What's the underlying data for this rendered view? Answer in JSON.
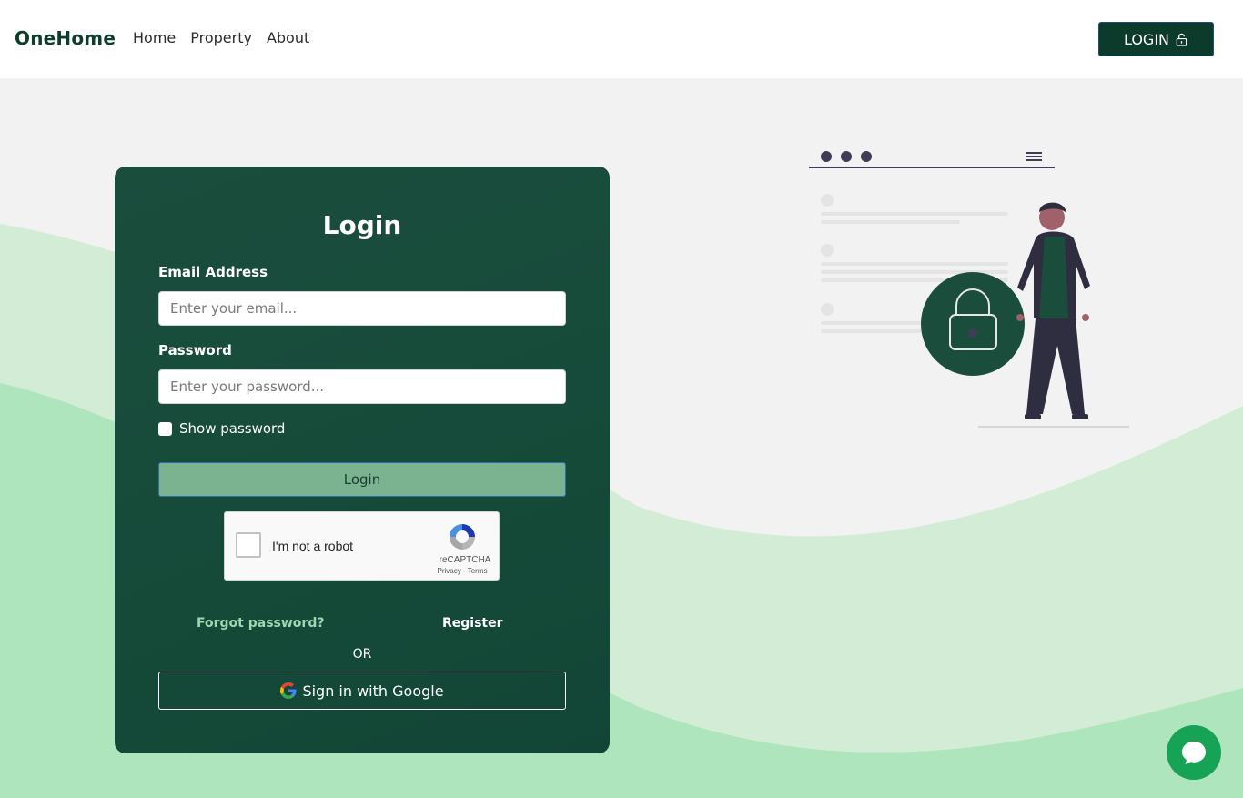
{
  "header": {
    "brand": "OneHome",
    "nav": [
      "Home",
      "Property",
      "About"
    ],
    "login_label": "LOGIN"
  },
  "form": {
    "title": "Login",
    "email_label": "Email Address",
    "email_placeholder": "Enter your email...",
    "password_label": "Password",
    "password_placeholder": "Enter your password...",
    "show_password_label": "Show password",
    "submit_label": "Login",
    "recaptcha": {
      "label": "I'm not a robot",
      "brand": "reCAPTCHA",
      "links": "Privacy - Terms"
    },
    "forgot_label": "Forgot password?",
    "register_label": "Register",
    "or_label": "OR",
    "google_label": "Sign in with Google"
  },
  "colors": {
    "brand_green": "#0c3b2b",
    "card_green": "#1b4d3d",
    "button_green": "#7bb28f",
    "chat_green": "#17a355",
    "wave_light": "#d3ecd6",
    "wave_mid": "#aee5bd"
  },
  "icons": {
    "login_button_icon": "unlock-icon",
    "google_icon": "google-g-icon",
    "chat_icon": "chat-bubble-icon",
    "illustration": "person-with-lock-illustration"
  }
}
